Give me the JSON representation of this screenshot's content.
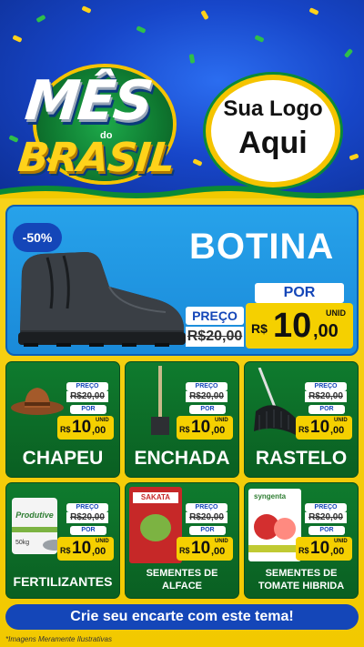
{
  "header": {
    "title_line1": "MÊS",
    "title_small": "do",
    "title_line2": "BRASIL",
    "logo_line1": "Sua Logo",
    "logo_line2": "Aqui"
  },
  "hero": {
    "discount": "-50%",
    "name": "BOTINA",
    "por_label": "POR",
    "preco_label": "PREÇO",
    "old_price": "R$20,00",
    "currency": "R$",
    "price_int": "10",
    "price_dec": ",00",
    "unit": "UNID"
  },
  "products": [
    {
      "name": "CHAPEU",
      "preco_label": "PREÇO",
      "old_price": "R$20,00",
      "por_label": "POR",
      "currency": "R$",
      "price_int": "10",
      "price_dec": ",00",
      "unit": "UNID",
      "image": "hat-icon"
    },
    {
      "name": "ENCHADA",
      "preco_label": "PREÇO",
      "old_price": "R$20,00",
      "por_label": "POR",
      "currency": "R$",
      "price_int": "10",
      "price_dec": ",00",
      "unit": "UNID",
      "image": "hoe-icon"
    },
    {
      "name": "RASTELO",
      "preco_label": "PREÇO",
      "old_price": "R$20,00",
      "por_label": "POR",
      "currency": "R$",
      "price_int": "10",
      "price_dec": ",00",
      "unit": "UNID",
      "image": "rake-icon"
    },
    {
      "name": "FERTILIZANTES",
      "preco_label": "PREÇO",
      "old_price": "R$20,00",
      "por_label": "POR",
      "currency": "R$",
      "price_int": "10",
      "price_dec": ",00",
      "unit": "UNID",
      "image": "fertilizer-bag-icon",
      "pack_label": "Produtive",
      "pack_weight": "50kg"
    },
    {
      "name_line1": "SEMENTES DE",
      "name_line2": "ALFACE",
      "preco_label": "PREÇO",
      "old_price": "R$20,00",
      "por_label": "POR",
      "currency": "R$",
      "price_int": "10",
      "price_dec": ",00",
      "unit": "UNID",
      "image": "seed-packet-icon",
      "pack_label": "SAKATA"
    },
    {
      "name_line1": "SEMENTES DE",
      "name_line2": "TOMATE HIBRIDA",
      "preco_label": "PREÇO",
      "old_price": "R$20,00",
      "por_label": "POR",
      "currency": "R$",
      "price_int": "10",
      "price_dec": ",00",
      "unit": "UNID",
      "image": "tomato-seed-packet-icon",
      "pack_label": "syngenta"
    }
  ],
  "footer": {
    "cta": "Crie seu encarte com este tema!",
    "note": "*Imagens Meramente Ilustrativas"
  },
  "colors": {
    "blue": "#1446b8",
    "yellow": "#f5d000",
    "green": "#0f7b2e",
    "sky": "#27a2ea"
  }
}
